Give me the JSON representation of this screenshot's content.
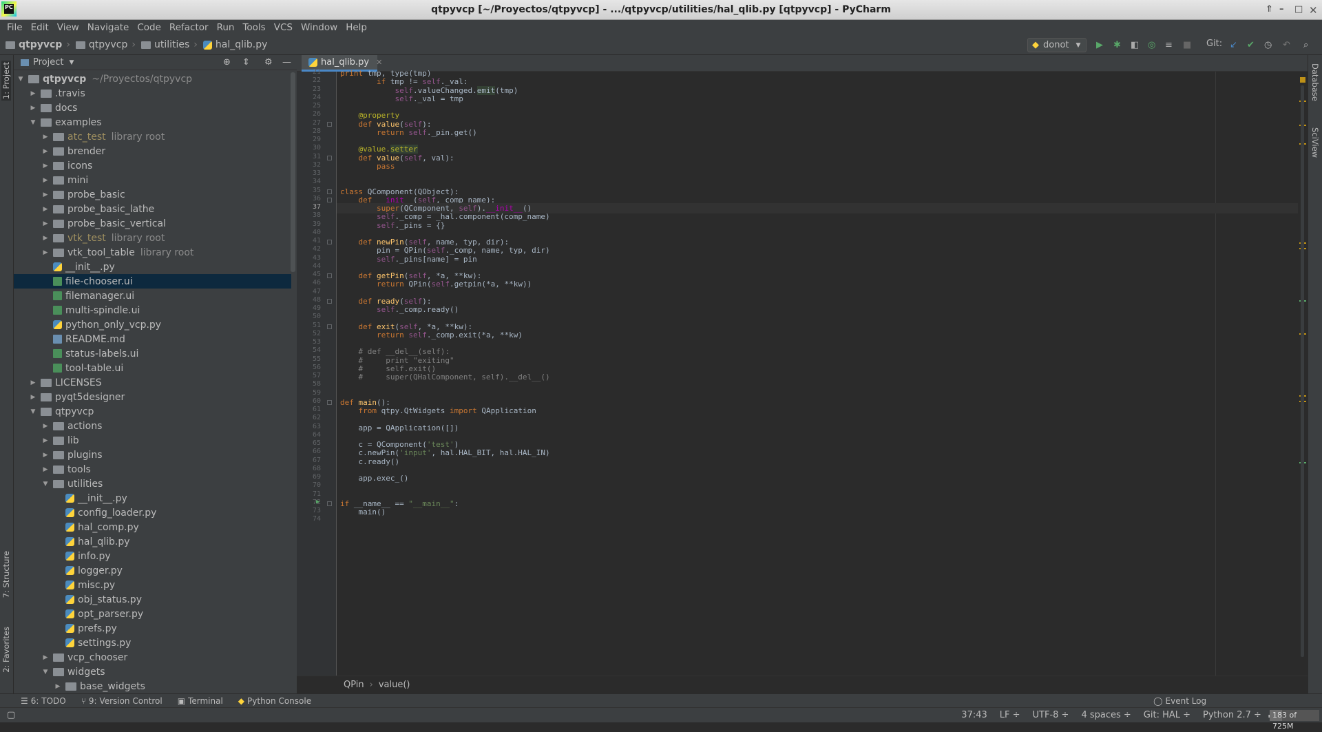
{
  "window": {
    "title": "qtpyvcp [~/Proyectos/qtpyvcp] - .../qtpyvcp/utilities/hal_qlib.py [qtpyvcp] - PyCharm"
  },
  "menu": [
    "File",
    "Edit",
    "View",
    "Navigate",
    "Code",
    "Refactor",
    "Run",
    "Tools",
    "VCS",
    "Window",
    "Help"
  ],
  "breadcrumbs": [
    "qtpyvcp",
    "qtpyvcp",
    "utilities",
    "hal_qlib.py"
  ],
  "toolbar": {
    "run_config": "donot",
    "git_label": "Git:"
  },
  "left_strip": {
    "project": "1: Project",
    "structure": "7: Structure",
    "favorites": "2: Favorites"
  },
  "right_strip": {
    "database": "Database",
    "sciview": "SciView"
  },
  "project_panel": {
    "title": "Project"
  },
  "tree": [
    {
      "label": "qtpyvcp",
      "hint": "~/Proyectos/qtpyvcp",
      "type": "dir",
      "depth": 0,
      "open": true,
      "bold": true
    },
    {
      "label": ".travis",
      "type": "dir",
      "depth": 1
    },
    {
      "label": "docs",
      "type": "dir",
      "depth": 1
    },
    {
      "label": "examples",
      "type": "dir",
      "depth": 1,
      "open": true
    },
    {
      "label": "atc_test",
      "hint": "library root",
      "type": "dir",
      "depth": 2,
      "lib": true
    },
    {
      "label": "brender",
      "type": "dir",
      "depth": 2
    },
    {
      "label": "icons",
      "type": "dir",
      "depth": 2
    },
    {
      "label": "mini",
      "type": "dir",
      "depth": 2
    },
    {
      "label": "probe_basic",
      "type": "dir",
      "depth": 2
    },
    {
      "label": "probe_basic_lathe",
      "type": "dir",
      "depth": 2
    },
    {
      "label": "probe_basic_vertical",
      "type": "dir",
      "depth": 2
    },
    {
      "label": "vtk_test",
      "hint": "library root",
      "type": "dir",
      "depth": 2,
      "lib": true
    },
    {
      "label": "vtk_tool_table",
      "hint": "library root",
      "type": "dir",
      "depth": 2
    },
    {
      "label": "__init__.py",
      "type": "py",
      "depth": 2,
      "leaf": true
    },
    {
      "label": "file-chooser.ui",
      "type": "ui",
      "depth": 2,
      "leaf": true,
      "selected": true
    },
    {
      "label": "filemanager.ui",
      "type": "ui",
      "depth": 2,
      "leaf": true
    },
    {
      "label": "multi-spindle.ui",
      "type": "ui",
      "depth": 2,
      "leaf": true
    },
    {
      "label": "python_only_vcp.py",
      "type": "py",
      "depth": 2,
      "leaf": true
    },
    {
      "label": "README.md",
      "type": "md",
      "depth": 2,
      "leaf": true
    },
    {
      "label": "status-labels.ui",
      "type": "ui",
      "depth": 2,
      "leaf": true
    },
    {
      "label": "tool-table.ui",
      "type": "ui",
      "depth": 2,
      "leaf": true
    },
    {
      "label": "LICENSES",
      "type": "dir",
      "depth": 1
    },
    {
      "label": "pyqt5designer",
      "type": "dir",
      "depth": 1
    },
    {
      "label": "qtpyvcp",
      "type": "dir",
      "depth": 1,
      "open": true
    },
    {
      "label": "actions",
      "type": "dir",
      "depth": 2
    },
    {
      "label": "lib",
      "type": "dir",
      "depth": 2
    },
    {
      "label": "plugins",
      "type": "dir",
      "depth": 2
    },
    {
      "label": "tools",
      "type": "dir",
      "depth": 2
    },
    {
      "label": "utilities",
      "type": "dir",
      "depth": 2,
      "open": true
    },
    {
      "label": "__init__.py",
      "type": "py",
      "depth": 3,
      "leaf": true
    },
    {
      "label": "config_loader.py",
      "type": "py",
      "depth": 3,
      "leaf": true
    },
    {
      "label": "hal_comp.py",
      "type": "py",
      "depth": 3,
      "leaf": true
    },
    {
      "label": "hal_qlib.py",
      "type": "py",
      "depth": 3,
      "leaf": true
    },
    {
      "label": "info.py",
      "type": "py",
      "depth": 3,
      "leaf": true
    },
    {
      "label": "logger.py",
      "type": "py",
      "depth": 3,
      "leaf": true
    },
    {
      "label": "misc.py",
      "type": "py",
      "depth": 3,
      "leaf": true
    },
    {
      "label": "obj_status.py",
      "type": "py",
      "depth": 3,
      "leaf": true
    },
    {
      "label": "opt_parser.py",
      "type": "py",
      "depth": 3,
      "leaf": true
    },
    {
      "label": "prefs.py",
      "type": "py",
      "depth": 3,
      "leaf": true
    },
    {
      "label": "settings.py",
      "type": "py",
      "depth": 3,
      "leaf": true
    },
    {
      "label": "vcp_chooser",
      "type": "dir",
      "depth": 2
    },
    {
      "label": "widgets",
      "type": "dir",
      "depth": 2,
      "open": true
    },
    {
      "label": "base_widgets",
      "type": "dir",
      "depth": 3
    }
  ],
  "editor": {
    "tab": "hal_qlib.py",
    "current_line": 37,
    "lines": [
      {
        "n": 21,
        "h": "<span class='kw'>print</span> tmp, type(tmp)"
      },
      {
        "n": 22,
        "h": "        <span class='kw'>if</span> tmp != <span class='sf'>self</span>._val:"
      },
      {
        "n": 23,
        "h": "            <span class='sf'>self</span>.valueChanged.<span class='hl'>emit</span>(tmp)"
      },
      {
        "n": 24,
        "h": "            <span class='sf'>self</span>._val = tmp"
      },
      {
        "n": 25,
        "h": ""
      },
      {
        "n": 26,
        "h": "    <span class='dec'>@property</span>"
      },
      {
        "n": 27,
        "h": "    <span class='kw'>def</span> <span class='fn'>value</span>(<span class='sf'>self</span>):"
      },
      {
        "n": 28,
        "h": "        <span class='kw'>return</span> <span class='sf'>self</span>._pin.get()"
      },
      {
        "n": 29,
        "h": ""
      },
      {
        "n": 30,
        "h": "    <span class='dec'>@value.</span><span class='dec hl'>setter</span>"
      },
      {
        "n": 31,
        "h": "    <span class='kw'>def</span> <span class='fn'>value</span>(<span class='sf'>self</span>, val):"
      },
      {
        "n": 32,
        "h": "        <span class='kw'>pass</span>"
      },
      {
        "n": 33,
        "h": ""
      },
      {
        "n": 34,
        "h": ""
      },
      {
        "n": 35,
        "h": "<span class='kw'>class</span> QComponent(QObject):"
      },
      {
        "n": 36,
        "h": "    <span class='kw'>def</span> <span class='mg'>__init__</span>(<span class='sf'>self</span>, comp_name):"
      },
      {
        "n": 37,
        "h": "        <span class='kw'>super</span>(QComponent, <span class='sf'>self</span>).<span class='mg'>__init__</span>()"
      },
      {
        "n": 38,
        "h": "        <span class='sf'>self</span>._comp = _hal.component(comp_name)"
      },
      {
        "n": 39,
        "h": "        <span class='sf'>self</span>._pins = {}"
      },
      {
        "n": 40,
        "h": ""
      },
      {
        "n": 41,
        "h": "    <span class='kw'>def</span> <span class='fn'>newPin</span>(<span class='sf'>self</span>, name, typ, dir):"
      },
      {
        "n": 42,
        "h": "        pin = QPin(<span class='sf'>self</span>._comp, name, typ, dir)"
      },
      {
        "n": 43,
        "h": "        <span class='sf'>self</span>._pins[name] = pin"
      },
      {
        "n": 44,
        "h": ""
      },
      {
        "n": 45,
        "h": "    <span class='kw'>def</span> <span class='fn'>getPin</span>(<span class='sf'>self</span>, *a, **kw):"
      },
      {
        "n": 46,
        "h": "        <span class='kw'>return</span> QPin(<span class='sf'>self</span>.getpin(*a, **kw))"
      },
      {
        "n": 47,
        "h": ""
      },
      {
        "n": 48,
        "h": "    <span class='kw'>def</span> <span class='fn'>ready</span>(<span class='sf'>self</span>):"
      },
      {
        "n": 49,
        "h": "        <span class='sf'>self</span>._comp.ready()"
      },
      {
        "n": 50,
        "h": ""
      },
      {
        "n": 51,
        "h": "    <span class='kw'>def</span> <span class='fn'>exit</span>(<span class='sf'>self</span>, *a, **kw):"
      },
      {
        "n": 52,
        "h": "        <span class='kw'>return</span> <span class='sf'>self</span>._comp.exit(*a, **kw)"
      },
      {
        "n": 53,
        "h": ""
      },
      {
        "n": 54,
        "h": "    <span class='cm'># def __del__(self):</span>"
      },
      {
        "n": 55,
        "h": "    <span class='cm'>#     print \"exiting\"</span>"
      },
      {
        "n": 56,
        "h": "    <span class='cm'>#     self.exit()</span>"
      },
      {
        "n": 57,
        "h": "    <span class='cm'>#     super(QHalComponent, self).__del__()</span>"
      },
      {
        "n": 58,
        "h": ""
      },
      {
        "n": 59,
        "h": ""
      },
      {
        "n": 60,
        "h": "<span class='kw'>def</span> <span class='fn'>main</span>():"
      },
      {
        "n": 61,
        "h": "    <span class='kw'>from</span> qtpy.QtWidgets <span class='kw'>import</span> QApplication"
      },
      {
        "n": 62,
        "h": ""
      },
      {
        "n": 63,
        "h": "    app = QApplication([])"
      },
      {
        "n": 64,
        "h": ""
      },
      {
        "n": 65,
        "h": "    c = QComponent(<span class='st'>'test'</span>)"
      },
      {
        "n": 66,
        "h": "    c.newPin(<span class='st'>'input'</span>, hal.HAL_BIT, hal.HAL_IN)"
      },
      {
        "n": 67,
        "h": "    c.ready()"
      },
      {
        "n": 68,
        "h": ""
      },
      {
        "n": 69,
        "h": "    app.exec_()"
      },
      {
        "n": 70,
        "h": ""
      },
      {
        "n": 71,
        "h": ""
      },
      {
        "n": 72,
        "h": "<span class='kw'>if</span> __name__ == <span class='st'>\"__main__\"</span>:"
      },
      {
        "n": 73,
        "h": "    main()"
      },
      {
        "n": 74,
        "h": ""
      }
    ],
    "breadcrumb": [
      "QPin",
      "value()"
    ]
  },
  "tool_windows": [
    "6: TODO",
    "9: Version Control",
    "Terminal",
    "Python Console"
  ],
  "event_log": "Event Log",
  "status": {
    "position": "37:43",
    "line_sep": "LF ÷",
    "encoding": "UTF-8 ÷",
    "indent": "4 spaces ÷",
    "git": "Git: HAL ÷",
    "interpreter": "Python 2.7 ÷",
    "memory": "183 of 725M",
    "memory_fraction": 0.25
  },
  "colors": {
    "bg": "#2b2b2b",
    "panel": "#3c3f41",
    "keyword": "#cc7832",
    "self": "#94558d",
    "string": "#6a8759",
    "function": "#ffc66d"
  }
}
